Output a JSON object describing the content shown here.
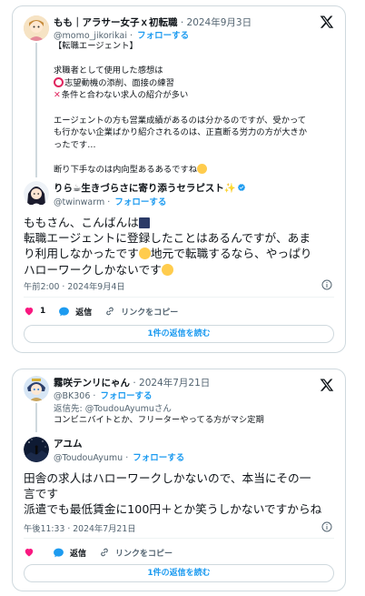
{
  "tweet1": {
    "quoted": {
      "name": "もも｜アラサー女子ｘ初転職",
      "date": "· 2024年9月3日",
      "handle": "@momo_jikorikai",
      "follow": "フォローする",
      "lines": [
        "【転職エージェント】",
        "",
        "求職者として使用した感想は",
        "志望動機の添削、面接の練習",
        "条件と合わない求人の紹介が多い",
        "",
        "エージェントの方も営業成績があるのは分かるのですが、受かって",
        "も行かない企業ばかり紹介されるのは、正直断る労力の方が大きか",
        "ったです…",
        "",
        "断り下手なのは内向型あるあるですね"
      ]
    },
    "reply": {
      "name": "りら☕生きづらさに寄り添うセラピスト",
      "handle": "@twinwarm",
      "follow": "フォローする",
      "lines": [
        "ももさん、こんばんは",
        "転職エージェントに登録したことはあるんですが、あま",
        "り利用しなかったです",
        "地元で転職するなら、やっぱり",
        "ハローワークしかないです"
      ],
      "timestamp": "午前2:00 · 2024年9月4日",
      "like_count": "1",
      "reply_label": "返信",
      "copy_link_label": "リンクをコピー",
      "read_replies": "1件の返信を読む"
    }
  },
  "tweet2": {
    "quoted": {
      "name": "霧咲テンリにゃん",
      "date": "· 2024年7月21日",
      "handle": "@BK306",
      "follow": "フォローする",
      "replying_to": "返信先: @ToudouAyumuさん",
      "text": "コンビニバイトとか、フリーターやってる方がマシ定期"
    },
    "reply": {
      "name": "アユム",
      "handle": "@ToudouAyumu",
      "follow": "フォローする",
      "lines": [
        "田舎の求人はハローワークしかないので、本当にその一",
        "言です",
        "派遣でも最低賃金に100円＋とか笑うしかないですからね"
      ],
      "timestamp": "午後11:33 · 2024年7月21日",
      "reply_label": "返信",
      "copy_link_label": "リンクをコピー",
      "read_replies": "1件の返信を読む"
    }
  },
  "colors": {
    "like": "#f91880",
    "accent": "#1d9bf0",
    "muted": "#536471"
  }
}
